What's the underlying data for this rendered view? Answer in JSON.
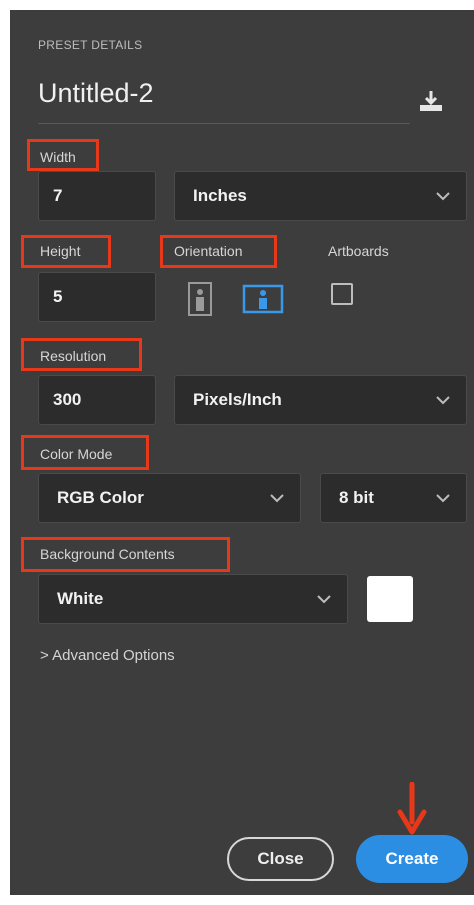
{
  "preset": {
    "section_label": "PRESET DETAILS",
    "title": "Untitled-2"
  },
  "width": {
    "label": "Width",
    "value": "7",
    "unit": "Inches"
  },
  "height": {
    "label": "Height",
    "value": "5"
  },
  "orientation": {
    "label": "Orientation",
    "selected": "landscape"
  },
  "artboards": {
    "label": "Artboards",
    "checked": false
  },
  "resolution": {
    "label": "Resolution",
    "value": "300",
    "unit": "Pixels/Inch"
  },
  "color_mode": {
    "label": "Color Mode",
    "value": "RGB Color",
    "bit_depth": "8 bit"
  },
  "background": {
    "label": "Background Contents",
    "value": "White",
    "swatch_color": "#ffffff"
  },
  "advanced": {
    "label": "> Advanced Options"
  },
  "buttons": {
    "close": "Close",
    "create": "Create"
  },
  "colors": {
    "panel_bg": "#3d3d3d",
    "field_bg": "#2c2c2c",
    "accent": "#2c8ee3",
    "annotation": "#e8381a"
  }
}
